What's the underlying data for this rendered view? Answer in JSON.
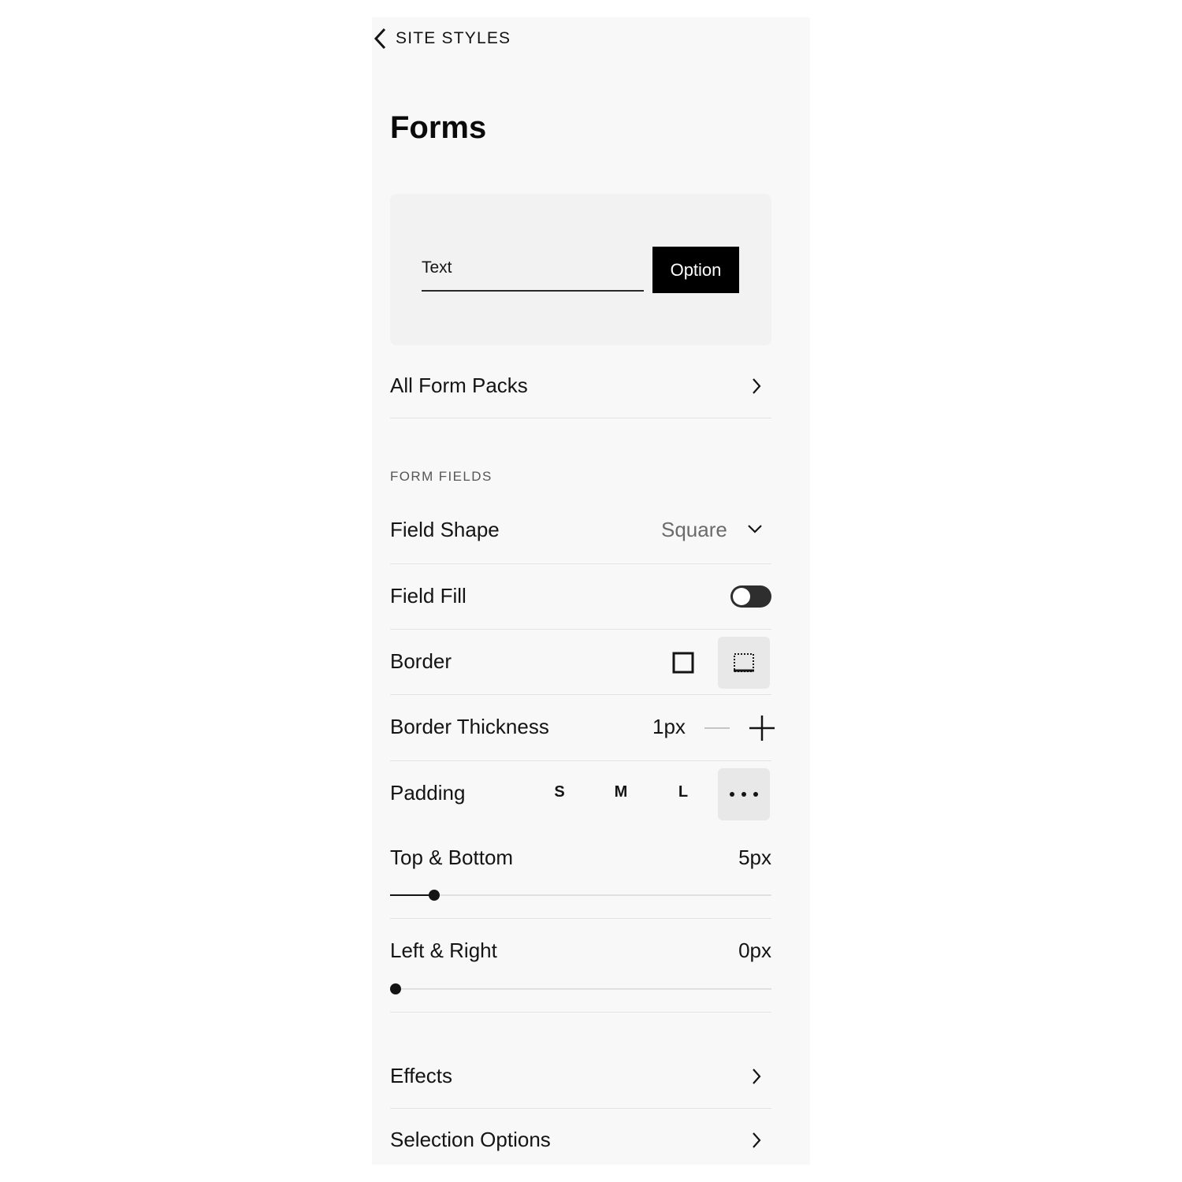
{
  "header": {
    "back_label": "SITE STYLES"
  },
  "page": {
    "title": "Forms"
  },
  "preview": {
    "field_text": "Text",
    "button_label": "Option"
  },
  "packs": {
    "label": "All Form Packs"
  },
  "form_fields": {
    "section_label": "FORM FIELDS",
    "field_shape": {
      "label": "Field Shape",
      "value": "Square"
    },
    "field_fill": {
      "label": "Field Fill",
      "enabled": false
    },
    "border": {
      "label": "Border",
      "options": [
        "solid-border-icon",
        "dotted-border-icon"
      ],
      "selected": "dotted-border-icon"
    },
    "border_thickness": {
      "label": "Border Thickness",
      "value": "1px"
    },
    "padding": {
      "label": "Padding",
      "options": [
        "S",
        "M",
        "L"
      ],
      "selected": "custom"
    },
    "top_bottom": {
      "label": "Top & Bottom",
      "value": "5px",
      "slider_fraction": 0.115
    },
    "left_right": {
      "label": "Left & Right",
      "value": "0px",
      "slider_fraction": 0.0
    }
  },
  "links": [
    {
      "label": "Effects"
    },
    {
      "label": "Selection Options"
    }
  ]
}
